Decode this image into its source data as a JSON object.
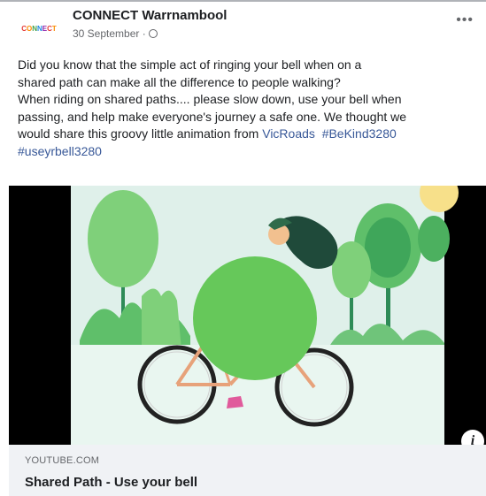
{
  "post": {
    "page_name": "CONNECT Warrnambool",
    "date": "30 September ·",
    "avatar_text": "CONNECT",
    "privacy_icon": "globe-icon",
    "more_icon": "more-options-icon",
    "text_lines": [
      "Did you know that the simple act of ringing your bell when on a",
      "shared path can make all the difference to people walking?",
      "When riding on shared paths.... please slow down, use your bell when",
      "passing, and help make everyone's journey a safe one. We thought we",
      "would share this groovy little animation from "
    ],
    "mention": "VicRoads",
    "hashtag_1": "#BeKind3280",
    "hashtag_2": "#useyrbell3280"
  },
  "video": {
    "info_label": "i"
  },
  "link_preview": {
    "domain": "YOUTUBE.COM",
    "title": "Shared Path - Use your bell"
  },
  "colors": {
    "link": "#385898",
    "secondary_text": "#65676b",
    "preview_bg": "#f0f2f5",
    "video_sky": "#dff0ea",
    "green_circle": "#66c85a"
  }
}
